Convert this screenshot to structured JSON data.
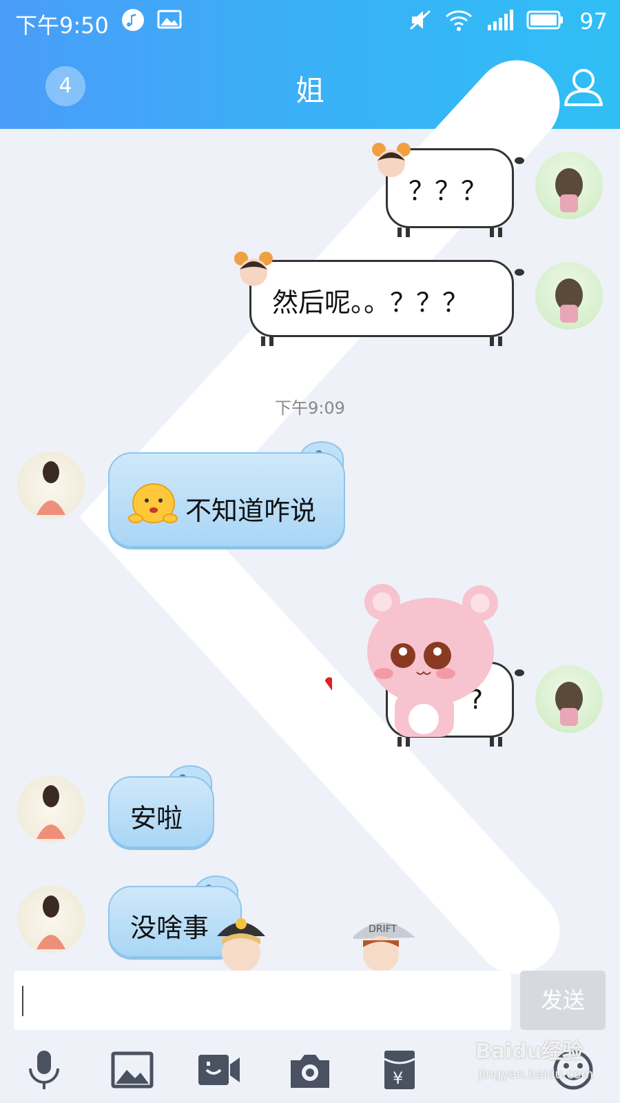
{
  "status_bar": {
    "time": "下午9:50",
    "battery": "97"
  },
  "title_bar": {
    "unread_count": "4",
    "title": "姐"
  },
  "messages": [
    {
      "side": "right",
      "text": "？？？"
    },
    {
      "side": "right",
      "text": "然后呢。。？？？"
    },
    {
      "side": "left",
      "text": "不知道咋说"
    },
    {
      "side": "right",
      "text": "?"
    },
    {
      "side": "left",
      "text": "安啦"
    },
    {
      "side": "left",
      "text": "没啥事"
    }
  ],
  "timestamp": "下午9:09",
  "input": {
    "value": ""
  },
  "send_label": "发送",
  "toolbar_icons": [
    "microphone-icon",
    "image-icon",
    "video-call-icon",
    "camera-icon",
    "red-packet-icon",
    "emoji-icon"
  ],
  "watermark": {
    "line1": "Baidu经验",
    "line2": "jingyan.baidu.com"
  },
  "colors": {
    "header_start": "#4a9df8",
    "header_end": "#2fbff5",
    "bubble_blue": "#a9d6f5",
    "background": "#eef1f8"
  }
}
